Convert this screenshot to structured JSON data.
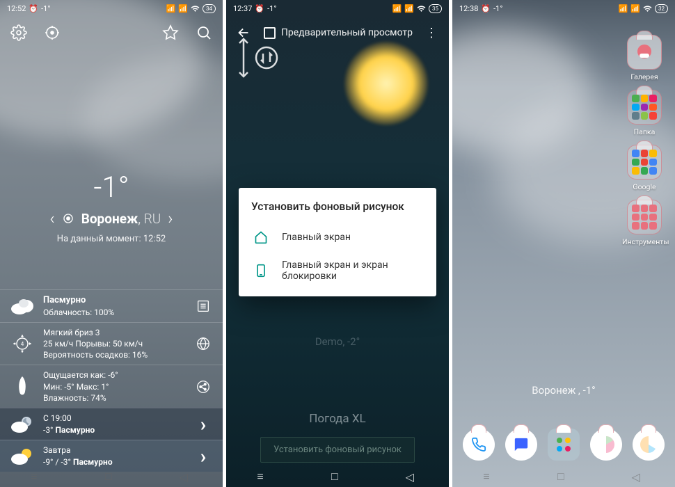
{
  "screen1": {
    "status": {
      "time": "12:52",
      "temp": "-1°",
      "battery": "34"
    },
    "main_temp": "-1°",
    "city": "Воронеж",
    "country": "RU",
    "asof_prefix": "На данный момент:",
    "asof_time": "12:52",
    "row1": {
      "title": "Пасмурно",
      "sub": "Облачность: 100%"
    },
    "row2": {
      "l1": "Мягкий бриз 3",
      "l2": "25 км/ч Порывы: 50 км/ч",
      "l3": "Вероятность осадков: 16%"
    },
    "row3": {
      "l1": "Ощущается как: -6°",
      "l2": "Мин: -5° Макс: 1°",
      "l3": "Влажность: 74%"
    },
    "row4": {
      "l1": "С 19:00",
      "l2a": "-3°",
      "l2b": "Пасмурно"
    },
    "row5": {
      "l1": "Завтра",
      "l2a": "-9° / -3°",
      "l2b": "Пасмурно"
    }
  },
  "screen2": {
    "status": {
      "time": "12:37",
      "temp": "-1°",
      "battery": "35"
    },
    "preview_label": "Предварительный просмотр",
    "dialog_title": "Установить фоновый рисунок",
    "opt1": "Главный экран",
    "opt2": "Главный экран и экран блокировки",
    "demo_label": "Demo, -2°",
    "widget_title": "Погода XL",
    "set_btn": "Установить фоновый рисунок"
  },
  "screen3": {
    "status": {
      "time": "12:38",
      "temp": "-1°",
      "battery": "32"
    },
    "apps": {
      "gallery": "Галерея",
      "folder": "Папка",
      "google": "Google",
      "tools": "Инструменты"
    },
    "widget_text": "Воронеж ,  -1°"
  }
}
